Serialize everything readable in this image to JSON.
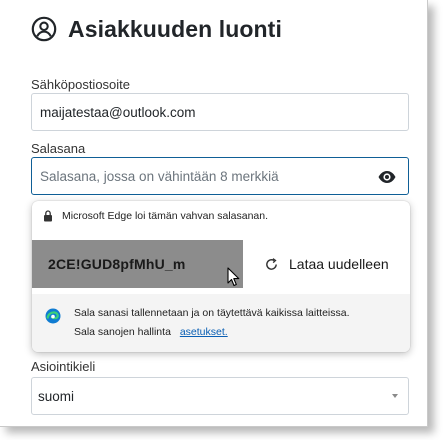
{
  "page": {
    "title": "Asiakkuuden luonti",
    "title_icon": "account-circle-icon"
  },
  "form": {
    "email": {
      "label": "Sähköpostiosoite",
      "value": "maijatestaa@outlook.com"
    },
    "password": {
      "label": "Salasana",
      "placeholder": "Salasana, jossa on vähintään 8 merkkiä",
      "toggle_icon": "eye-icon"
    },
    "language": {
      "label": "Asiointikieli",
      "value": "suomi"
    }
  },
  "password_suggestion": {
    "note": "Microsoft Edge loi tämän vahvan salasanan.",
    "generated_password": "2CE!GUD8pfMhU_m",
    "reload_label": "Lataa uudelleen",
    "footer_line1": "Sala sanasi tallennetaan ja on täytettävä kaikissa laitteissa.",
    "footer_line2_prefix": "Sala sanojen hallinta",
    "footer_link": "asetukset."
  },
  "colors": {
    "focus_border": "#0f5f96",
    "suggestion_bg": "#8c8c8c",
    "link": "#0a5fb4"
  }
}
